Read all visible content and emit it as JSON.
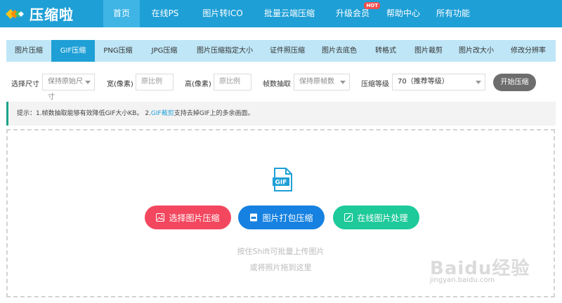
{
  "app": {
    "logo_text": "压缩啦"
  },
  "nav": [
    {
      "label": "首页",
      "active": true
    },
    {
      "label": "在线PS"
    },
    {
      "label": "图片转ICO"
    },
    {
      "label": "批量云端压缩"
    },
    {
      "label": "升级会员",
      "badge": "HOT"
    },
    {
      "label": "帮助中心"
    },
    {
      "label": "所有功能"
    }
  ],
  "subnav": [
    {
      "label": "图片压缩"
    },
    {
      "label": "GIF压缩",
      "active": true
    },
    {
      "label": "PNG压缩"
    },
    {
      "label": "JPG压缩"
    },
    {
      "label": "图片压缩指定大小"
    },
    {
      "label": "证件照压缩"
    },
    {
      "label": "图片去底色"
    },
    {
      "label": "转格式"
    },
    {
      "label": "图片裁剪"
    },
    {
      "label": "图片改大小"
    },
    {
      "label": "修改分辨率"
    }
  ],
  "options": {
    "size_label": "选择尺寸",
    "size_value": "保持原始尺寸",
    "width_label": "宽(像素)",
    "width_placeholder": "原比例",
    "height_label": "高(像素)",
    "height_placeholder": "原比例",
    "frame_label": "帧数抽取",
    "frame_value": "保持原帧数",
    "level_label": "压缩等级",
    "level_value": "70（推荐等级）",
    "start_label": "开始压缩"
  },
  "tip": {
    "prefix": "提示：1.帧数抽取能够有效降低GIF大小KB。 2.",
    "link": "GIF裁剪",
    "suffix": "支持去掉GIF上的多余画面。"
  },
  "upload": {
    "icon_text": "GIF",
    "btn_select": "选择图片压缩",
    "btn_pack": "图片打包压缩",
    "btn_online": "在线图片处理",
    "hint_line1": "按住Shift可批量上传图片",
    "hint_line2": "或将照片拖到这里"
  },
  "watermark": {
    "big": "Baidu经验",
    "small": "jingyan.baidu.com"
  },
  "colors": {
    "primary": "#1e9fd6",
    "red": "#f2475e",
    "blue": "#1681e0",
    "green": "#1ec99a",
    "tip_accent": "#1aa38a"
  }
}
